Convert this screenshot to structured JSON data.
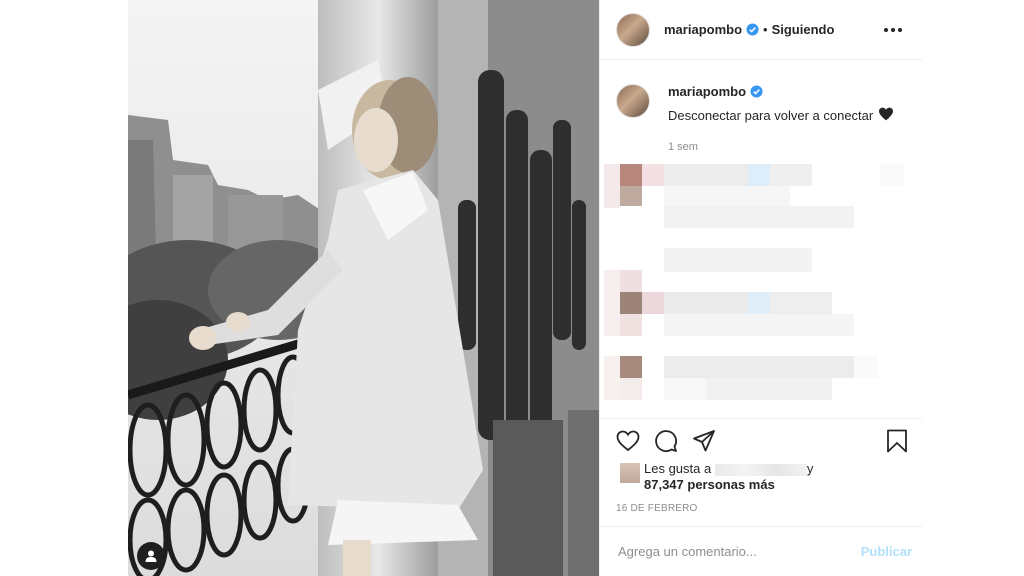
{
  "post": {
    "author": "mariapombo",
    "follow_status": "Siguiendo",
    "separator": "•",
    "caption": "Desconectar para volver a conectar",
    "caption_emoji": "black-heart-icon",
    "time_ago": "1 sem",
    "likes_prefix": "Les gusta a",
    "likes_suffix": "y",
    "likes_count_text": "87,347 personas más",
    "date": "16 DE FEBRERO"
  },
  "comment": {
    "placeholder": "Agrega un comentario...",
    "post_label": "Publicar"
  },
  "colors": {
    "verified": "#3897f0",
    "post_button_disabled": "#b2dffc",
    "secondary_text": "#8e8e8e",
    "border": "#efefef"
  },
  "icons": [
    "verified-badge-icon",
    "more-options-icon",
    "like-heart-icon",
    "comment-icon",
    "share-icon",
    "save-bookmark-icon",
    "user-tag-icon",
    "black-heart-icon"
  ]
}
